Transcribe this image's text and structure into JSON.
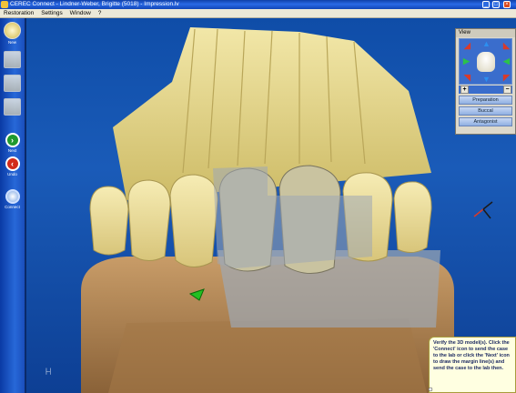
{
  "window": {
    "title": "CEREC Connect - Lindner-Weber, Brigitte (5018) - Impression.lv",
    "controls": {
      "minimize": "_",
      "maximize": "□",
      "close": "×"
    }
  },
  "menu": [
    "Restoration",
    "Settings",
    "Window",
    "?"
  ],
  "sidebar": {
    "new": "New",
    "next": "Next",
    "undo": "Undo",
    "connect": "Connect"
  },
  "view_panel": {
    "title": "View",
    "zoom_in": "+",
    "zoom_out": "−",
    "buttons": [
      "Preparation",
      "Buccal",
      "Antagonist"
    ]
  },
  "hint_text": "Verify the 3D model(s). Click the 'Connect' icon to send the case to the lab or click the 'Next' icon to draw the margin line(s) and send the case to the lab then.",
  "icons": {
    "app": "cerec-logo-icon",
    "arrows": [
      "up",
      "down",
      "left",
      "right",
      "up-left",
      "up-right",
      "down-left",
      "down-right"
    ]
  },
  "colors": {
    "model_yellow": "#e8d98a",
    "overlay_gray": "#9ea8b4",
    "antagonist_tan": "#c89c68",
    "viewport_blue": "#1a5bb8"
  }
}
